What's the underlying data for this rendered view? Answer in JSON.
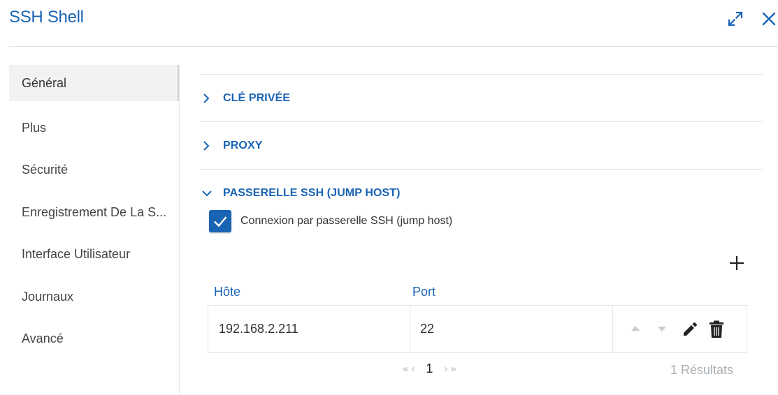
{
  "window": {
    "title": "SSH Shell",
    "expand_icon": "expand-icon",
    "close_icon": "close-icon"
  },
  "sidebar": {
    "items": [
      {
        "label": "Général",
        "active": true
      },
      {
        "label": "Plus",
        "active": false
      },
      {
        "label": "Sécurité",
        "active": false
      },
      {
        "label": "Enregistrement De La S...",
        "active": false
      },
      {
        "label": "Interface Utilisateur",
        "active": false
      },
      {
        "label": "Journaux",
        "active": false
      },
      {
        "label": "Avancé",
        "active": false
      }
    ]
  },
  "sections": [
    {
      "label": "CLÉ PRIVÉE",
      "expanded": false
    },
    {
      "label": "PROXY",
      "expanded": false
    },
    {
      "label": "PASSERELLE SSH (JUMP HOST)",
      "expanded": true
    }
  ],
  "jump_host": {
    "checkbox_label": "Connexion par passerelle SSH (jump host)",
    "checked": true,
    "columns": {
      "host": "Hôte",
      "port": "Port"
    },
    "rows": [
      {
        "host": "192.168.2.211",
        "port": "22"
      }
    ],
    "pager": {
      "first": "«",
      "prev": "‹",
      "page": "1",
      "next": "›",
      "last": "»"
    },
    "results": "1 Résultats"
  },
  "colors": {
    "accent": "#1a64b4",
    "muted": "#a8aeb3"
  }
}
